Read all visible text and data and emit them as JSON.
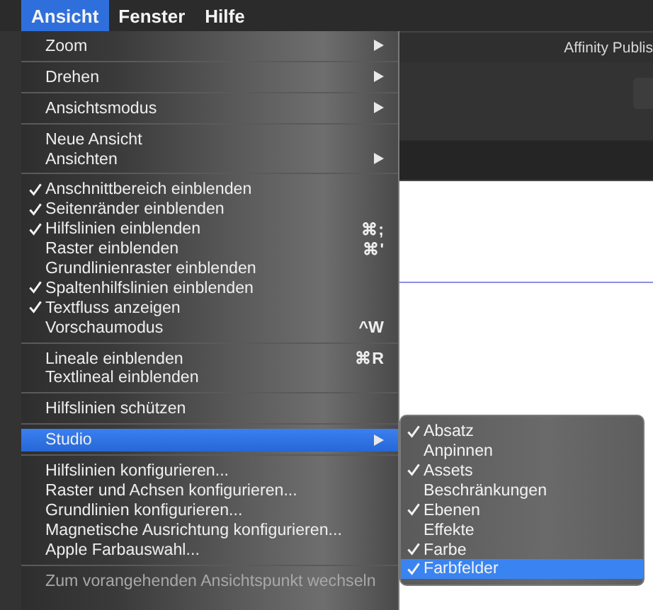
{
  "menu_bar": [
    {
      "label": "Ansicht",
      "selected": true
    },
    {
      "label": "Fenster",
      "selected": false
    },
    {
      "label": "Hilfe",
      "selected": false
    }
  ],
  "app_window": {
    "title": "Affinity Publis"
  },
  "menu": {
    "groups": [
      [
        {
          "label": "Zoom",
          "checked": false,
          "submenu": true,
          "selected": false,
          "disabled": false
        }
      ],
      [
        {
          "label": "Drehen",
          "checked": false,
          "submenu": true,
          "selected": false,
          "disabled": false
        }
      ],
      [
        {
          "label": "Ansichtsmodus",
          "checked": false,
          "submenu": true,
          "selected": false,
          "disabled": false
        }
      ],
      [
        {
          "label": "Neue Ansicht",
          "checked": false,
          "submenu": false,
          "selected": false,
          "disabled": false
        },
        {
          "label": "Ansichten",
          "checked": false,
          "submenu": true,
          "selected": false,
          "disabled": false
        }
      ],
      [
        {
          "label": "Anschnittbereich einblenden",
          "checked": true,
          "submenu": false,
          "selected": false,
          "disabled": false
        },
        {
          "label": "Seitenränder einblenden",
          "checked": true,
          "submenu": false,
          "selected": false,
          "disabled": false
        },
        {
          "label": "Hilfslinien einblenden",
          "checked": true,
          "submenu": false,
          "selected": false,
          "disabled": false,
          "shortcut": "⌘;"
        },
        {
          "label": "Raster einblenden",
          "checked": false,
          "submenu": false,
          "selected": false,
          "disabled": false,
          "shortcut": "⌘'"
        },
        {
          "label": "Grundlinienraster einblenden",
          "checked": false,
          "submenu": false,
          "selected": false,
          "disabled": false
        },
        {
          "label": "Spaltenhilfslinien einblenden",
          "checked": true,
          "submenu": false,
          "selected": false,
          "disabled": false
        },
        {
          "label": "Textfluss anzeigen",
          "checked": true,
          "submenu": false,
          "selected": false,
          "disabled": false
        },
        {
          "label": "Vorschaumodus",
          "checked": false,
          "submenu": false,
          "selected": false,
          "disabled": false,
          "shortcut": "^W"
        }
      ],
      [
        {
          "label": "Lineale einblenden",
          "checked": false,
          "submenu": false,
          "selected": false,
          "disabled": false,
          "shortcut": "⌘R"
        },
        {
          "label": "Textlineal einblenden",
          "checked": false,
          "submenu": false,
          "selected": false,
          "disabled": false
        }
      ],
      [
        {
          "label": "Hilfslinien schützen",
          "checked": false,
          "submenu": false,
          "selected": false,
          "disabled": false
        }
      ],
      [
        {
          "label": "Studio",
          "checked": false,
          "submenu": true,
          "selected": true,
          "disabled": false
        }
      ],
      [
        {
          "label": "Hilfslinien konfigurieren...",
          "checked": false,
          "submenu": false,
          "selected": false,
          "disabled": false
        },
        {
          "label": "Raster und Achsen konfigurieren...",
          "checked": false,
          "submenu": false,
          "selected": false,
          "disabled": false
        },
        {
          "label": "Grundlinien konfigurieren...",
          "checked": false,
          "submenu": false,
          "selected": false,
          "disabled": false
        },
        {
          "label": "Magnetische Ausrichtung konfigurieren...",
          "checked": false,
          "submenu": false,
          "selected": false,
          "disabled": false
        },
        {
          "label": "Apple Farbauswahl...",
          "checked": false,
          "submenu": false,
          "selected": false,
          "disabled": false
        }
      ],
      [
        {
          "label": "Zum vorangehenden Ansichtspunkt wechseln",
          "checked": false,
          "submenu": false,
          "selected": false,
          "disabled": true
        }
      ]
    ]
  },
  "submenu": {
    "items": [
      {
        "label": "Absatz",
        "checked": true,
        "selected": false
      },
      {
        "label": "Anpinnen",
        "checked": false,
        "selected": false
      },
      {
        "label": "Assets",
        "checked": true,
        "selected": false
      },
      {
        "label": "Beschränkungen",
        "checked": false,
        "selected": false
      },
      {
        "label": "Ebenen",
        "checked": true,
        "selected": false
      },
      {
        "label": "Effekte",
        "checked": false,
        "selected": false
      },
      {
        "label": "Farbe",
        "checked": true,
        "selected": false
      },
      {
        "label": "Farbfelder",
        "checked": true,
        "selected": true
      }
    ]
  }
}
